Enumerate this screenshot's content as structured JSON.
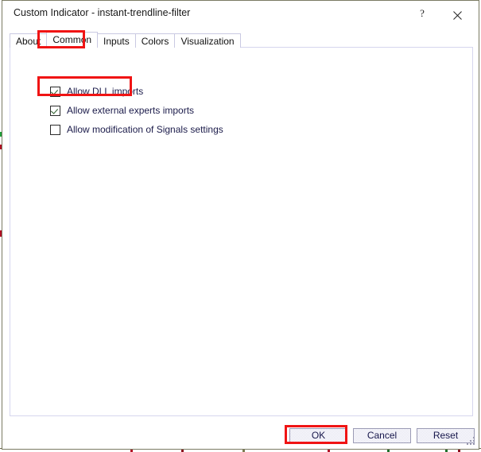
{
  "window": {
    "title": "Custom Indicator - instant-trendline-filter",
    "help_label": "?",
    "close_icon": "close-icon",
    "help_icon": "help-icon"
  },
  "tabs": [
    {
      "label": "About",
      "selected": false
    },
    {
      "label": "Common",
      "selected": true
    },
    {
      "label": "Inputs",
      "selected": false
    },
    {
      "label": "Colors",
      "selected": false
    },
    {
      "label": "Visualization",
      "selected": false
    }
  ],
  "common_tab": {
    "options": [
      {
        "label": "Allow DLL imports",
        "checked": true
      },
      {
        "label": "Allow external experts imports",
        "checked": true
      },
      {
        "label": "Allow modification of Signals settings",
        "checked": false
      }
    ]
  },
  "footer": {
    "ok_label": "OK",
    "cancel_label": "Cancel",
    "reset_label": "Reset"
  },
  "annotations": {
    "highlight_color": "#f01414",
    "targets": [
      "Common",
      "Allow DLL imports",
      "OK"
    ]
  },
  "colors": {
    "tab_border": "#c9c9e2",
    "panel_border": "#d6d6ee",
    "label_text": "#1b1b4a",
    "window_border": "#7a7a62",
    "button_border": "#9b9bb5"
  }
}
